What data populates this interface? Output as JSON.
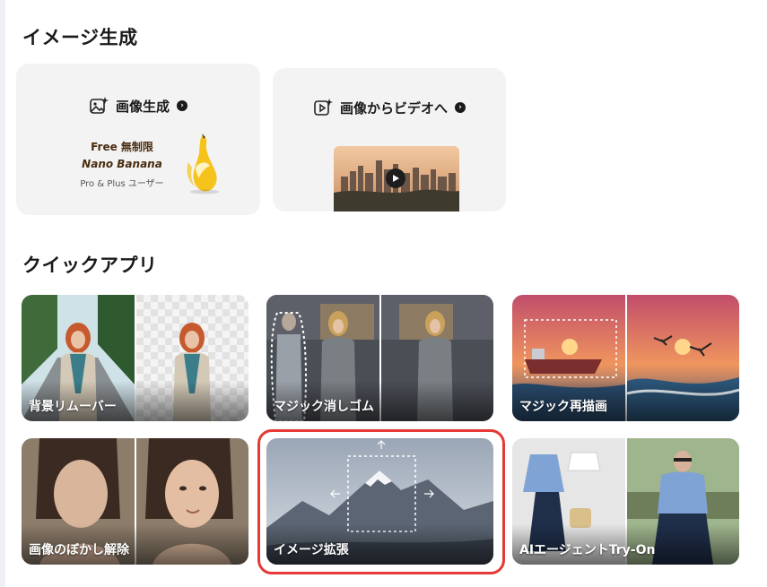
{
  "section_generate": {
    "title": "イメージ生成"
  },
  "card_image_gen": {
    "title": "画像生成",
    "icon": "image-sparkle-icon",
    "promo_line1": "Free 無制限",
    "promo_line2": "Nano Banana",
    "promo_line3": "Pro & Plus ユーザー"
  },
  "card_image_to_video": {
    "title": "画像からビデオへ",
    "icon": "video-sparkle-icon"
  },
  "section_quick": {
    "title": "クイックアプリ"
  },
  "quick_apps": [
    {
      "label": "背景リムーバー"
    },
    {
      "label": "マジック消しゴム"
    },
    {
      "label": "マジック再描画"
    },
    {
      "label": "画像のぼかし解除"
    },
    {
      "label": "イメージ拡張"
    },
    {
      "label": "AIエージェントTry-On"
    }
  ],
  "colors": {
    "selected_border": "#e53935",
    "card_bg": "#f3f3f4"
  }
}
